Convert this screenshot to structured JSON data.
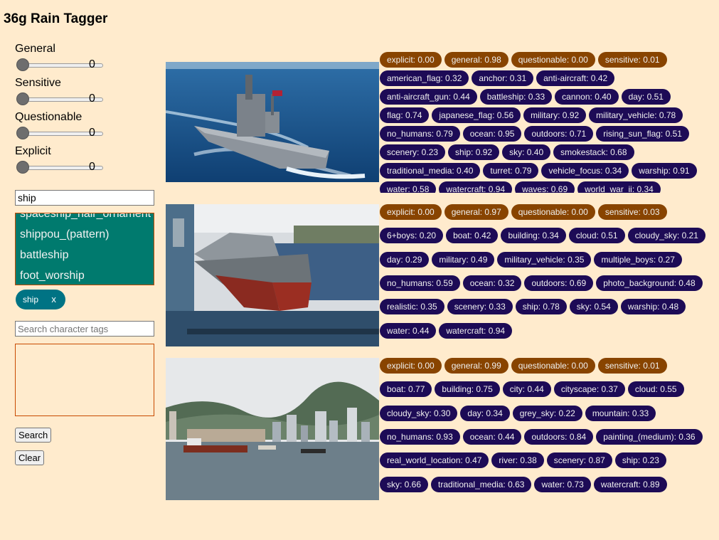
{
  "app": {
    "title": "36g Rain Tagger"
  },
  "sliders": [
    {
      "label": "General",
      "value": "0"
    },
    {
      "label": "Sensitive",
      "value": "0"
    },
    {
      "label": "Questionable",
      "value": "0"
    },
    {
      "label": "Explicit",
      "value": "0"
    }
  ],
  "search": {
    "value": "ship"
  },
  "suggestions": [
    "spaceship_hair_ornament",
    "shippou_(pattern)",
    "battleship",
    "foot_worship"
  ],
  "selected_tag": {
    "label": "ship",
    "close": "x"
  },
  "char_search": {
    "placeholder": "Search character tags"
  },
  "buttons": {
    "search": "Search",
    "clear": "Clear"
  },
  "colors": {
    "background": "#ffebcd",
    "rating_tag": "#884400",
    "general_tag": "#1d0b56",
    "suggestions_bg": "#007a6e",
    "chip": "#007384"
  },
  "results": [
    {
      "image": "warship-at-sea",
      "ratings": [
        "explicit: 0.00",
        "general: 0.98",
        "questionable: 0.00",
        "sensitive: 0.01"
      ],
      "tags": [
        "american_flag: 0.32",
        "anchor: 0.31",
        "anti-aircraft: 0.42",
        "anti-aircraft_gun: 0.44",
        "battleship: 0.33",
        "cannon: 0.40",
        "day: 0.51",
        "flag: 0.74",
        "japanese_flag: 0.56",
        "military: 0.92",
        "military_vehicle: 0.78",
        "no_humans: 0.79",
        "ocean: 0.95",
        "outdoors: 0.71",
        "rising_sun_flag: 0.51",
        "scenery: 0.23",
        "ship: 0.92",
        "sky: 0.40",
        "smokestack: 0.68",
        "traditional_media: 0.40",
        "turret: 0.79",
        "vehicle_focus: 0.34",
        "warship: 0.91",
        "water: 0.58",
        "watercraft: 0.94",
        "waves: 0.69",
        "world_war_ii: 0.34"
      ]
    },
    {
      "image": "destroyer-in-drydock",
      "ratings": [
        "explicit: 0.00",
        "general: 0.97",
        "questionable: 0.00",
        "sensitive: 0.03"
      ],
      "tags": [
        "6+boys: 0.20",
        "boat: 0.42",
        "building: 0.34",
        "cloud: 0.51",
        "cloudy_sky: 0.21",
        "day: 0.29",
        "military: 0.49",
        "military_vehicle: 0.35",
        "multiple_boys: 0.27",
        "no_humans: 0.59",
        "ocean: 0.32",
        "outdoors: 0.69",
        "photo_background: 0.48",
        "realistic: 0.35",
        "scenery: 0.33",
        "ship: 0.78",
        "sky: 0.54",
        "warship: 0.48",
        "water: 0.44",
        "watercraft: 0.94"
      ]
    },
    {
      "image": "harbor-cityscape",
      "ratings": [
        "explicit: 0.00",
        "general: 0.99",
        "questionable: 0.00",
        "sensitive: 0.01"
      ],
      "tags": [
        "boat: 0.77",
        "building: 0.75",
        "city: 0.44",
        "cityscape: 0.37",
        "cloud: 0.55",
        "cloudy_sky: 0.30",
        "day: 0.34",
        "grey_sky: 0.22",
        "mountain: 0.33",
        "no_humans: 0.93",
        "ocean: 0.44",
        "outdoors: 0.84",
        "painting_(medium): 0.36",
        "real_world_location: 0.47",
        "river: 0.38",
        "scenery: 0.87",
        "ship: 0.23",
        "sky: 0.66",
        "traditional_media: 0.63",
        "water: 0.73",
        "watercraft: 0.89"
      ]
    }
  ]
}
